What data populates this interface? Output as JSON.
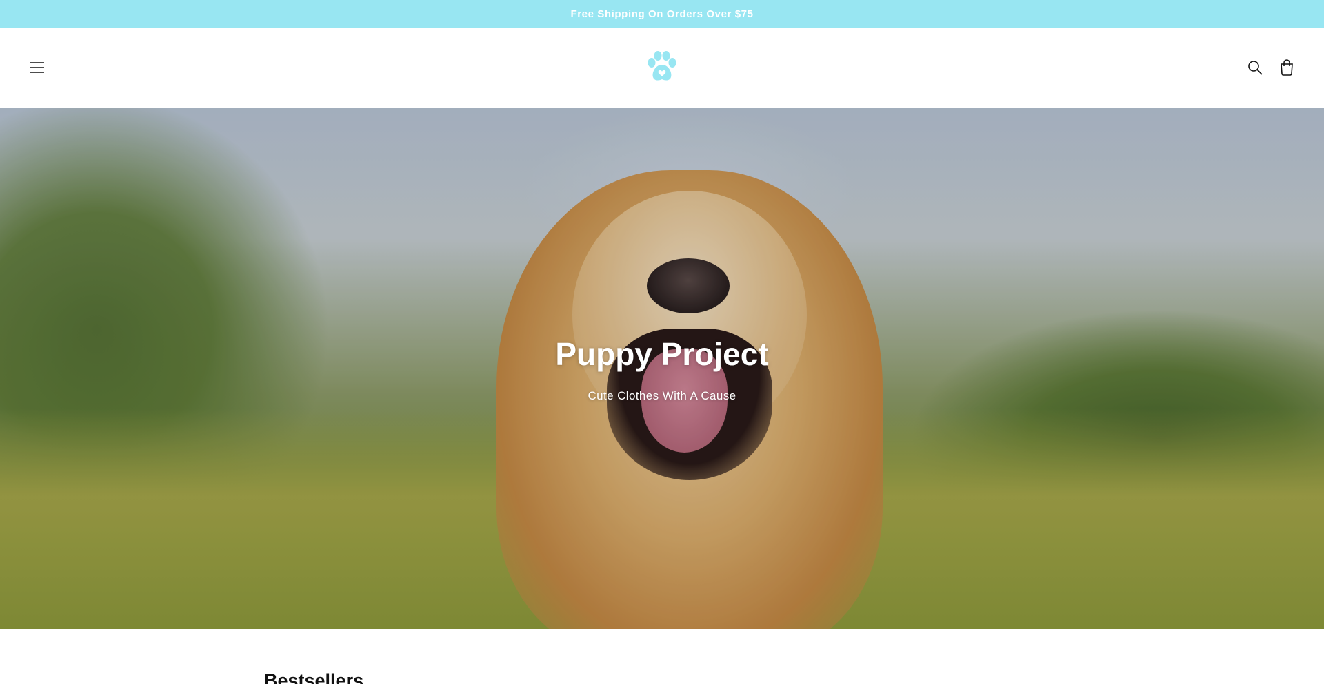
{
  "announcement": {
    "text": "Free Shipping On Orders Over $75"
  },
  "header": {
    "menu_icon": "hamburger-menu-icon",
    "logo_icon": "paw-heart-icon",
    "search_icon": "search-icon",
    "cart_icon": "cart-bag-icon",
    "brand_color": "#98e6f2"
  },
  "hero": {
    "title": "Puppy Project",
    "subtitle": "Cute Clothes With A Cause"
  },
  "bestsellers": {
    "title": "Bestsellers"
  }
}
